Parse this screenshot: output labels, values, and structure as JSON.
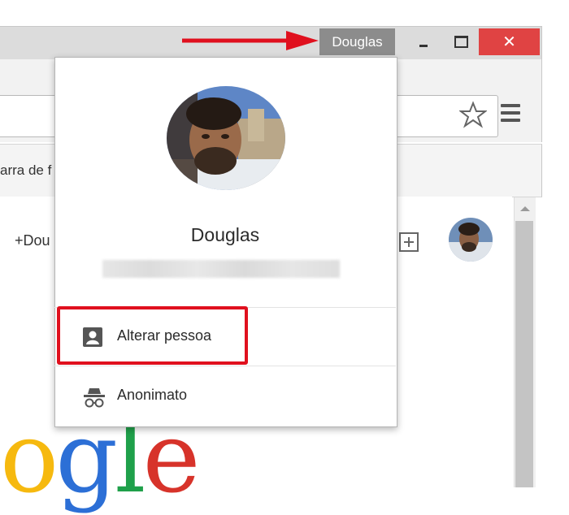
{
  "titlebar": {
    "profile_button": "Douglas",
    "close_glyph": "✕"
  },
  "bookmarks": {
    "partial_text": "arra de f"
  },
  "page": {
    "plus_user": "+Dou"
  },
  "dropdown": {
    "name": "Douglas",
    "items": [
      {
        "label": "Alterar pessoa",
        "icon": "person-icon"
      },
      {
        "label": "Anonimato",
        "icon": "incognito-icon"
      }
    ]
  },
  "logo": {
    "letters": [
      "o",
      "g",
      "l",
      "e"
    ]
  },
  "colors": {
    "close": "#e04343",
    "profile_button": "#8c8c8c",
    "highlight": "#e0101e",
    "arrow": "#e0101e"
  }
}
